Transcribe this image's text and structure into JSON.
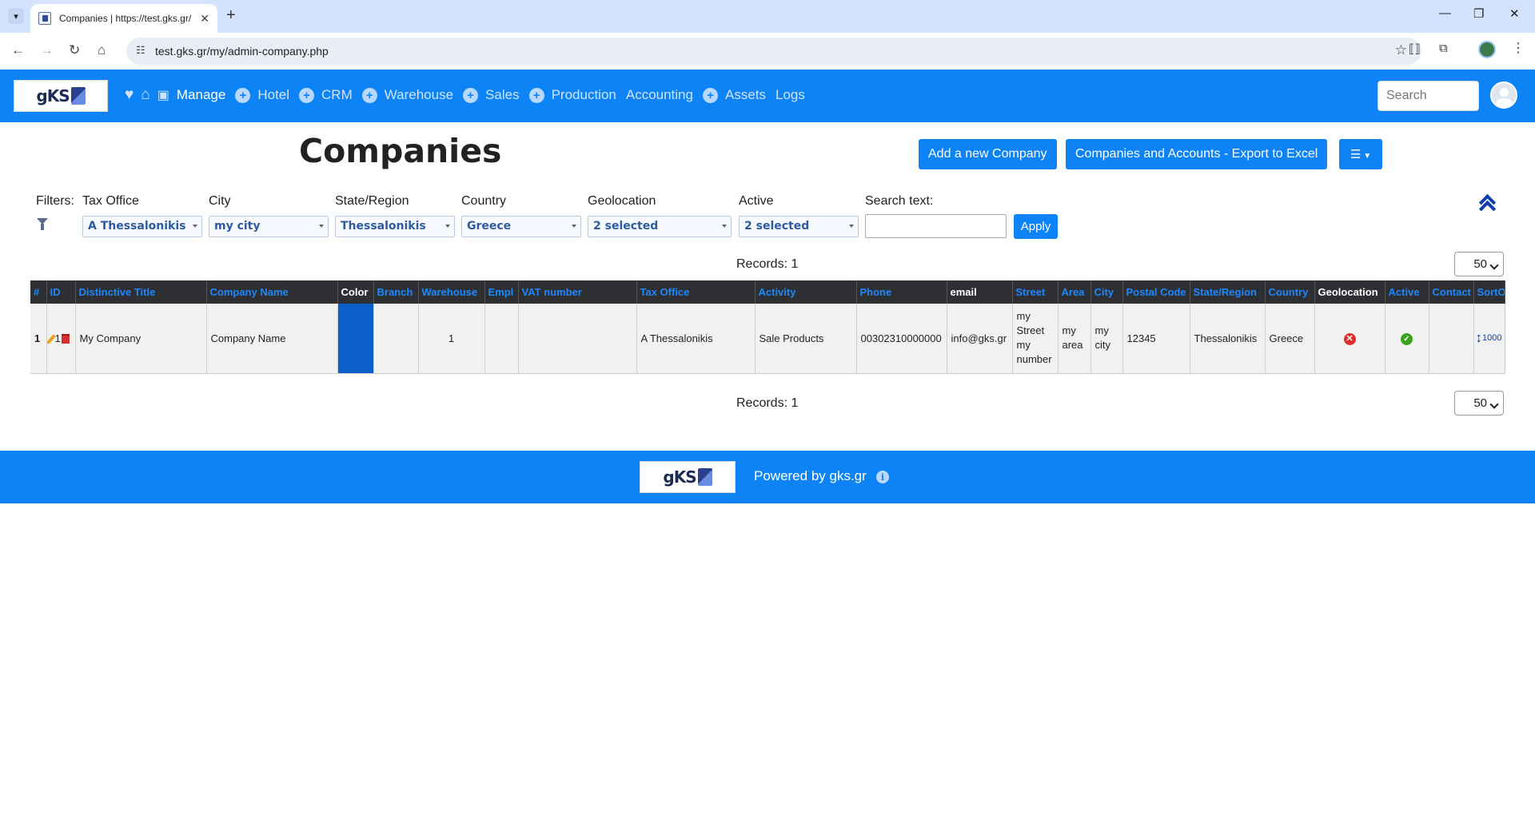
{
  "browser": {
    "tab_title": "Companies | https://test.gks.gr/",
    "url": "test.gks.gr/my/admin-company.php"
  },
  "app": {
    "nav": {
      "manage": "Manage",
      "hotel": "Hotel",
      "crm": "CRM",
      "warehouse": "Warehouse",
      "sales": "Sales",
      "production": "Production",
      "accounting": "Accounting",
      "assets": "Assets",
      "logs": "Logs"
    },
    "search_placeholder": "Search",
    "logo_text": "gKS"
  },
  "page": {
    "title": "Companies",
    "add_button": "Add a new Company",
    "export_button": "Companies and Accounts - Export to Excel"
  },
  "filters": {
    "label": "Filters:",
    "tax_office": {
      "label": "Tax Office",
      "value": "A Thessalonikis"
    },
    "city": {
      "label": "City",
      "value": "my city"
    },
    "state": {
      "label": "State/Region",
      "value": "Thessalonikis"
    },
    "country": {
      "label": "Country",
      "value": "Greece"
    },
    "geolocation": {
      "label": "Geolocation",
      "value": "2 selected"
    },
    "active": {
      "label": "Active",
      "value": "2 selected"
    },
    "search": {
      "label": "Search text:",
      "value": ""
    },
    "apply": "Apply"
  },
  "records": {
    "label": "Records: 1",
    "page_size": "50"
  },
  "table": {
    "headers": {
      "num": "#",
      "id": "ID",
      "distinctive": "Distinctive Title",
      "company": "Company Name",
      "color": "Color",
      "branch": "Branch",
      "warehouse": "Warehouse",
      "empl": "Empl",
      "vat": "VAT number",
      "tax_office": "Tax Office",
      "activity": "Activity",
      "phone": "Phone",
      "email": "email",
      "street": "Street",
      "area": "Area",
      "city": "City",
      "postal": "Postal Code",
      "state": "State/Region",
      "country": "Country",
      "geolocation": "Geolocation",
      "active": "Active",
      "contact": "Contact",
      "sorto": "SortO"
    },
    "row": {
      "num": "1",
      "id": "1",
      "distinctive": "My Company",
      "company": "Company Name",
      "color": "#0b5fc9",
      "branch": "",
      "warehouse": "1",
      "empl": "",
      "vat": "",
      "tax_office": "A Thessalonikis",
      "activity": "Sale Products",
      "phone": "00302310000000",
      "email": "info@gks.gr",
      "street": "my Street my number",
      "area": "my area",
      "city": "my city",
      "postal": "12345",
      "state": "Thessalonikis",
      "country": "Greece",
      "geolocation_icon": "x-circle-icon",
      "active_icon": "check-circle-icon",
      "contact": "",
      "sort_order": "1000"
    }
  },
  "footer": {
    "powered": "Powered by gks.gr",
    "logo_text": "gKS"
  }
}
